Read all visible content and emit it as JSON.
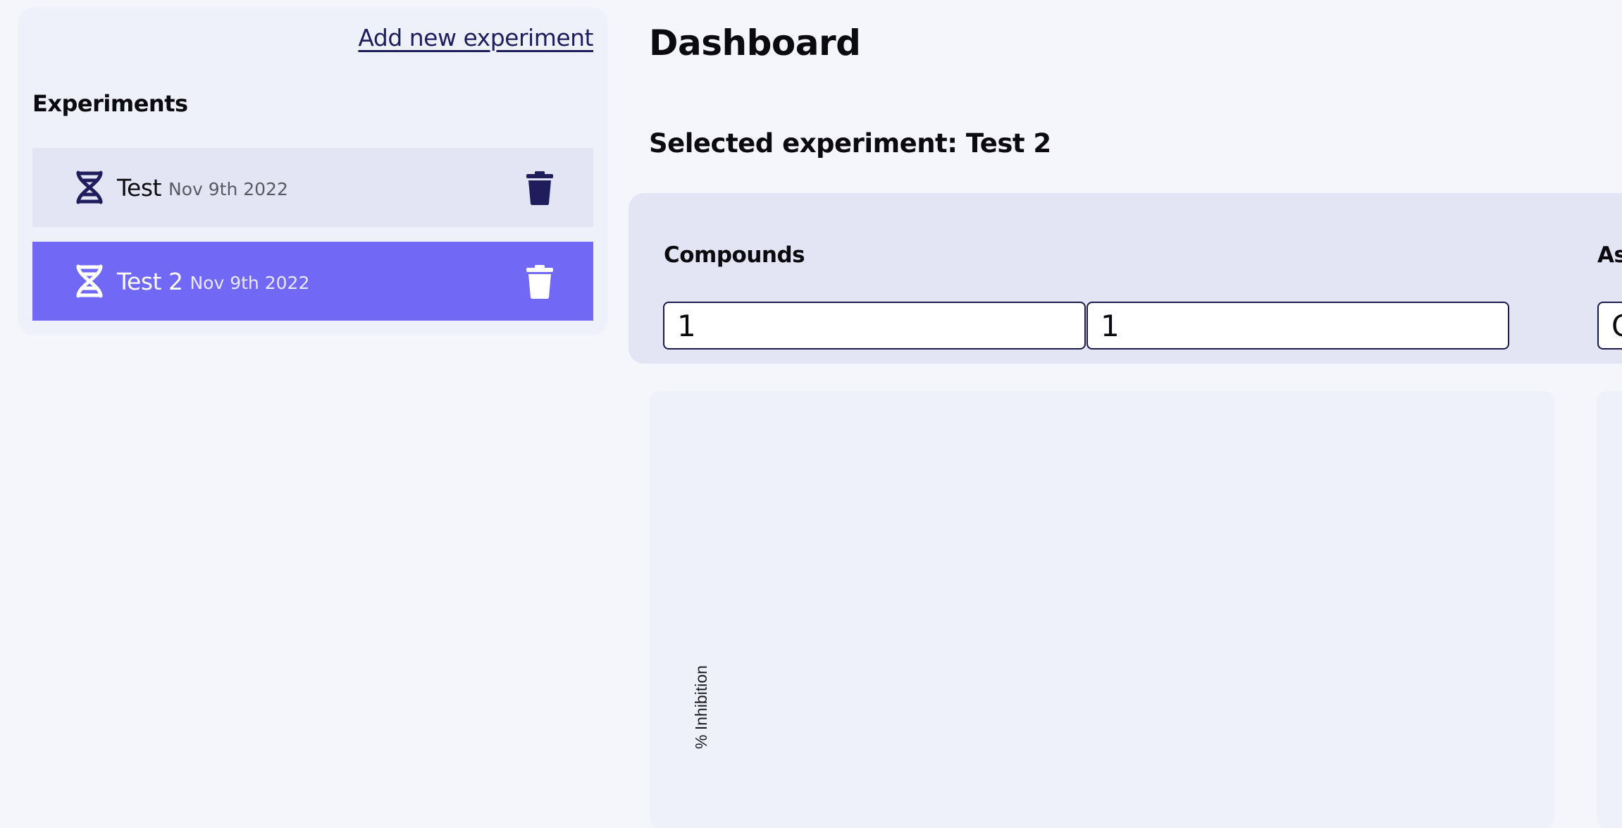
{
  "sidebar": {
    "add_link": "Add new experiment",
    "heading": "Experiments",
    "items": [
      {
        "name": "Test",
        "date": "Nov 9th 2022",
        "selected": false,
        "icon": "dna-icon",
        "action_icon": "trash-icon"
      },
      {
        "name": "Test 2",
        "date": "Nov 9th 2022",
        "selected": true,
        "icon": "dna-icon",
        "action_icon": "trash-icon"
      }
    ]
  },
  "main": {
    "title": "Dashboard",
    "selected_label": "Selected experiment: Test 2",
    "filters": {
      "compounds_heading": "Compounds",
      "compound_input_1": "1",
      "compound_input_2": "1",
      "assay_heading": "As",
      "assay_input": "C"
    },
    "chart": {
      "ylabel": "% Inhibition"
    }
  },
  "colors": {
    "accent": "#7168f5",
    "dark": "#1b1a4a",
    "panel": "#e3e4f4",
    "card": "#eef0fa",
    "background": "#f5f6fb"
  }
}
